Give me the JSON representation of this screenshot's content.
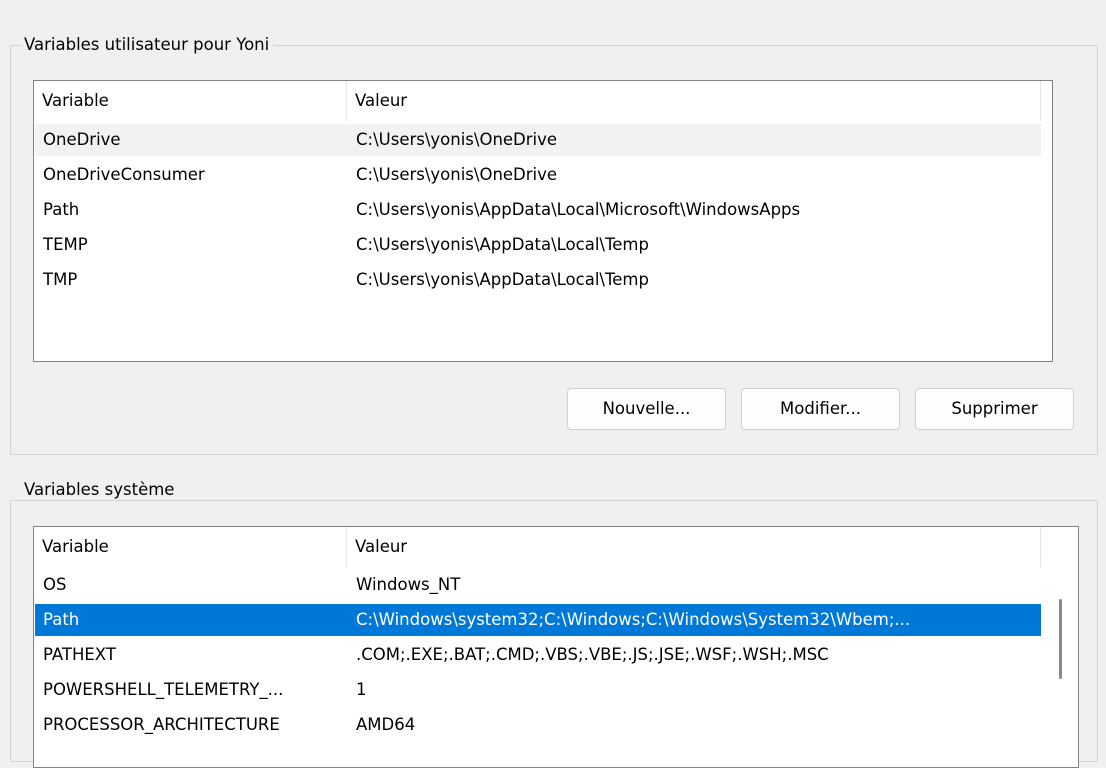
{
  "user_vars": {
    "group_title": "Variables utilisateur pour Yoni",
    "columns": [
      "Variable",
      "Valeur"
    ],
    "rows": [
      {
        "name": "OneDrive",
        "value": "C:\\Users\\yonis\\OneDrive"
      },
      {
        "name": "OneDriveConsumer",
        "value": "C:\\Users\\yonis\\OneDrive"
      },
      {
        "name": "Path",
        "value": "C:\\Users\\yonis\\AppData\\Local\\Microsoft\\WindowsApps"
      },
      {
        "name": "TEMP",
        "value": "C:\\Users\\yonis\\AppData\\Local\\Temp"
      },
      {
        "name": "TMP",
        "value": "C:\\Users\\yonis\\AppData\\Local\\Temp"
      }
    ],
    "buttons": {
      "new": "Nouvelle...",
      "edit": "Modifier...",
      "delete": "Supprimer"
    }
  },
  "system_vars": {
    "group_title": "Variables système",
    "columns": [
      "Variable",
      "Valeur"
    ],
    "rows": [
      {
        "name": "OS",
        "value": "Windows_NT"
      },
      {
        "name": "Path",
        "value": "C:\\Windows\\system32;C:\\Windows;C:\\Windows\\System32\\Wbem;..."
      },
      {
        "name": "PATHEXT",
        "value": ".COM;.EXE;.BAT;.CMD;.VBS;.VBE;.JS;.JSE;.WSF;.WSH;.MSC"
      },
      {
        "name": "POWERSHELL_TELEMETRY_...",
        "value": "1"
      },
      {
        "name": "PROCESSOR_ARCHITECTURE",
        "value": "AMD64"
      }
    ]
  },
  "colors": {
    "selection": "#0078d7",
    "hover_row": "#f2f2f2",
    "dialog_bg": "#f0f0f0"
  }
}
